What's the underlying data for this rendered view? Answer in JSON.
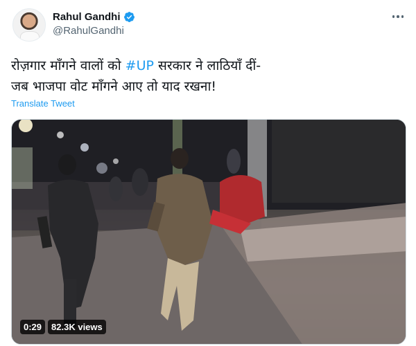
{
  "author": {
    "display_name": "Rahul Gandhi",
    "handle": "@RahulGandhi",
    "verified": true
  },
  "tweet": {
    "line1_before": "रोज़गार माँगने वालों को ",
    "hashtag": "#UP",
    "line1_after": " सरकार ने लाठियाँ दीं-",
    "line2": "जब भाजपा वोट माँगने आए तो याद रखना!",
    "translate_label": "Translate Tweet"
  },
  "video": {
    "duration": "0:29",
    "views": "82.3K views"
  },
  "icons": {
    "more": "more-horizontal-icon",
    "verified": "verified-badge-icon"
  },
  "colors": {
    "accent": "#1d9bf0",
    "text_primary": "#0f1419",
    "text_secondary": "#536471"
  }
}
